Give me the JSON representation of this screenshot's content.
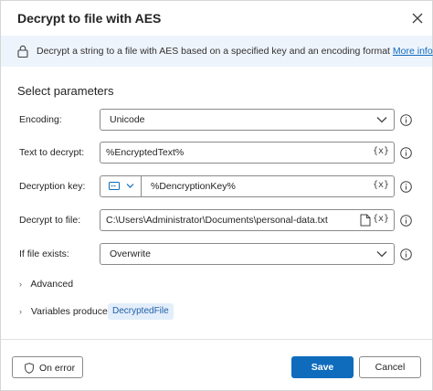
{
  "dialog": {
    "title": "Decrypt to file with AES",
    "banner": {
      "text": "Decrypt a string to a file with AES based on a specified key and an encoding format",
      "link": "More info"
    },
    "section_title": "Select parameters",
    "fields": {
      "encoding": {
        "label": "Encoding:",
        "value": "Unicode"
      },
      "text_to_decrypt": {
        "label": "Text to decrypt:",
        "value": "%EncryptedText%",
        "var_button": "{x}"
      },
      "decryption_key": {
        "label": "Decryption key:",
        "value": "%DencryptionKey%",
        "var_button": "{x}"
      },
      "decrypt_to_file": {
        "label": "Decrypt to file:",
        "value": "C:\\Users\\Administrator\\Documents\\personal-data.txt",
        "var_button": "{x}"
      },
      "if_file_exists": {
        "label": "If file exists:",
        "value": "Overwrite"
      }
    },
    "advanced_label": "Advanced",
    "variables_label": "Variables produced",
    "variables": [
      "DecryptedFile"
    ],
    "buttons": {
      "on_error": "On error",
      "save": "Save",
      "cancel": "Cancel"
    },
    "colors": {
      "accent": "#0f6cbd",
      "banner_bg": "#eef4fc",
      "pill_bg": "#e3eefb"
    }
  }
}
